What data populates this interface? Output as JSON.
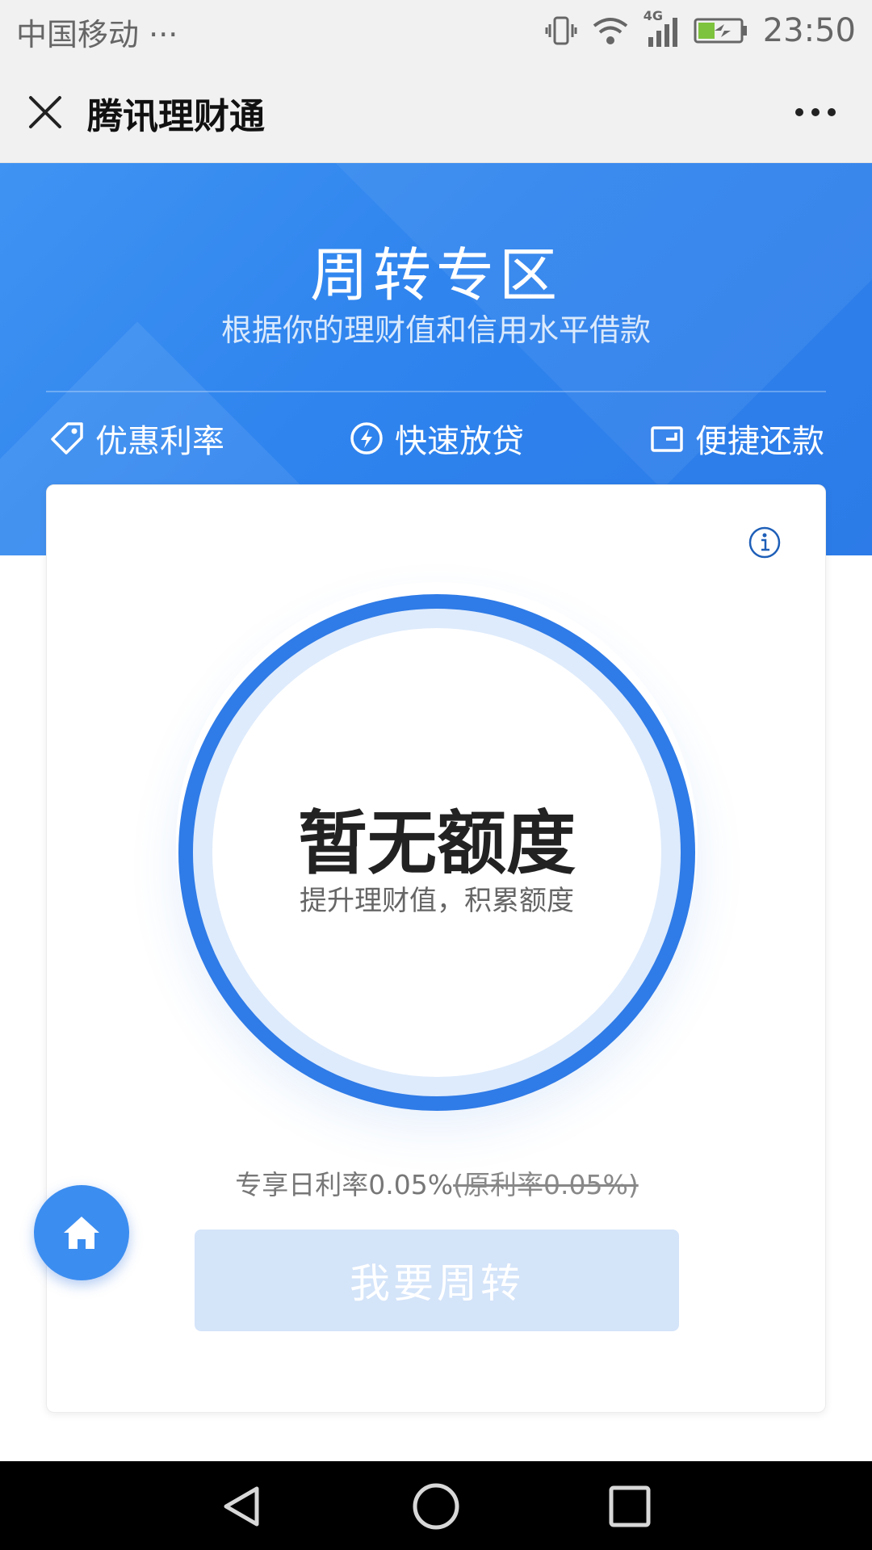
{
  "status_bar": {
    "carrier": "中国移动",
    "carrier_more": "···",
    "network": "4G",
    "time": "23:50"
  },
  "nav": {
    "title": "腾讯理财通"
  },
  "hero": {
    "title": "周转专区",
    "subtitle": "根据你的理财值和信用水平借款",
    "features": [
      {
        "label": "优惠利率",
        "icon": "tag-icon"
      },
      {
        "label": "快速放贷",
        "icon": "lightning-icon"
      },
      {
        "label": "便捷还款",
        "icon": "wallet-icon"
      }
    ]
  },
  "card": {
    "quota_status": "暂无额度",
    "quota_hint": "提升理财值，积累额度",
    "rate_text": "专享日利率0.05%",
    "rate_original": "(原利率0.05%)",
    "cta_label": "我要周转"
  },
  "colors": {
    "primary": "#2f7be7",
    "hero_start": "#3f93f2",
    "button_disabled": "#d4e4f9"
  }
}
